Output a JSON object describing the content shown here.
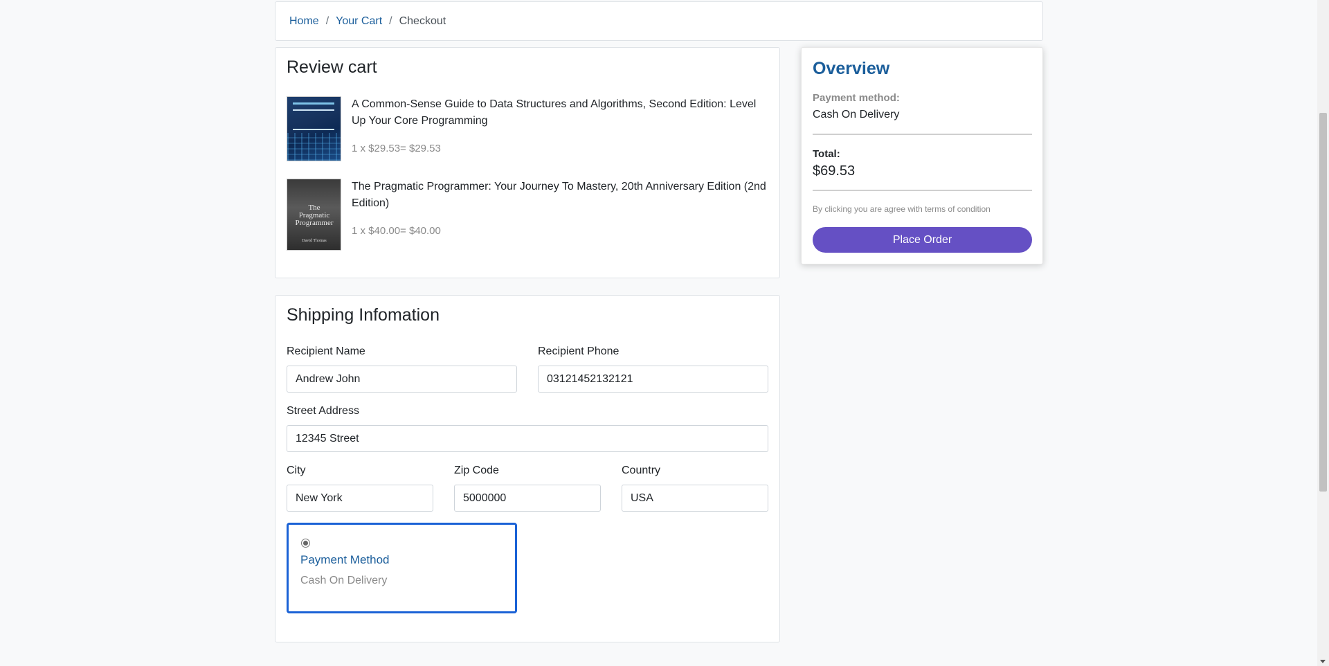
{
  "breadcrumb": {
    "items": [
      {
        "label": "Home"
      },
      {
        "label": "Your Cart"
      }
    ],
    "separator": "/",
    "current": "Checkout"
  },
  "review_cart": {
    "title": "Review cart",
    "items": [
      {
        "title": "A Common-Sense Guide to Data Structures and Algorithms, Second Edition: Level Up Your Core Programming",
        "price_line": "1 x $29.53= $29.53",
        "cover_icon": "book-cover-data-structures"
      },
      {
        "title": "The Pragmatic Programmer: Your Journey To Mastery, 20th Anniversary Edition (2nd Edition)",
        "price_line": "1 x $40.00= $40.00",
        "cover_icon": "book-cover-pragmatic-programmer"
      }
    ]
  },
  "shipping": {
    "title": "Shipping Infomation",
    "recipient_name": {
      "label": "Recipient Name",
      "value": "Andrew John"
    },
    "recipient_phone": {
      "label": "Recipient Phone",
      "value": "03121452132121"
    },
    "street_address": {
      "label": "Street Address",
      "value": "12345 Street"
    },
    "city": {
      "label": "City",
      "value": "New York"
    },
    "zip_code": {
      "label": "Zip Code",
      "value": "5000000"
    },
    "country": {
      "label": "Country",
      "value": "USA"
    },
    "payment": {
      "title": "Payment Method",
      "option": "Cash On Delivery",
      "selected": true
    }
  },
  "overview": {
    "title": "Overview",
    "payment_label": "Payment method:",
    "payment_value": "Cash On Delivery",
    "total_label": "Total:",
    "total_value": "$69.53",
    "terms": "By clicking you are agree with terms of condition",
    "place_order_label": "Place Order"
  },
  "colors": {
    "link": "#1b5e9b",
    "accent_button": "#6550c4",
    "selected_border": "#1a62d6",
    "page_bg": "#f8f9fa"
  }
}
